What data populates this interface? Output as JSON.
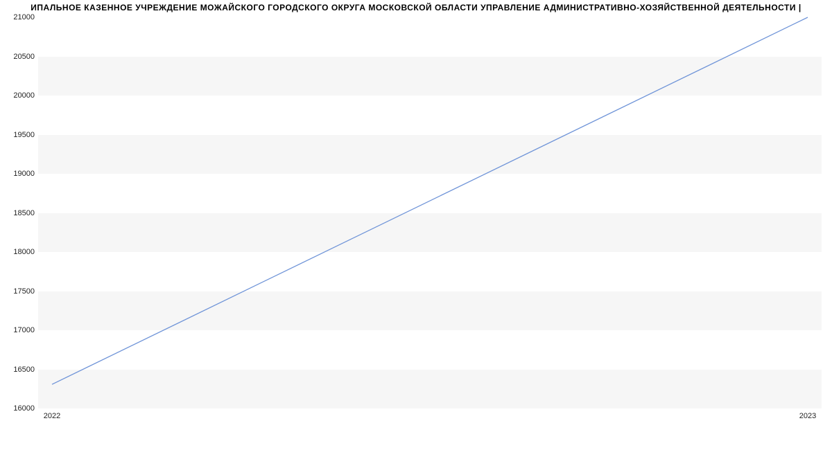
{
  "chart_data": {
    "type": "line",
    "title": "ИПАЛЬНОЕ КАЗЕННОЕ УЧРЕЖДЕНИЕ МОЖАЙСКОГО ГОРОДСКОГО ОКРУГА МОСКОВСКОЙ ОБЛАСТИ УПРАВЛЕНИЕ АДМИНИСТРАТИВНО-ХОЗЯЙСТВЕННОЙ ДЕЯТЕЛЬНОСТИ |",
    "categories": [
      "2022",
      "2023"
    ],
    "values": [
      16300,
      21000
    ],
    "xlabel": "",
    "ylabel": "",
    "ylim": [
      16000,
      21000
    ],
    "y_ticks": [
      16000,
      16500,
      17000,
      17500,
      18000,
      18500,
      19000,
      19500,
      20000,
      20500,
      21000
    ],
    "x_ticks": [
      "2022",
      "2023"
    ],
    "line_color": "#6f94d8",
    "band_color_a": "#f6f6f6",
    "band_color_b": "#ffffff"
  }
}
